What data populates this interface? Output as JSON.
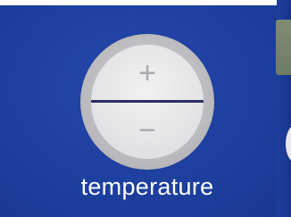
{
  "control": {
    "label": "temperature",
    "increase_symbol": "+",
    "decrease_symbol": "−"
  },
  "colors": {
    "background": "#1d3f9e",
    "button_face": "#e4e4e6",
    "button_rim": "#b8b8bc",
    "divider": "#2a2f63",
    "label_text": "#ffffff"
  }
}
